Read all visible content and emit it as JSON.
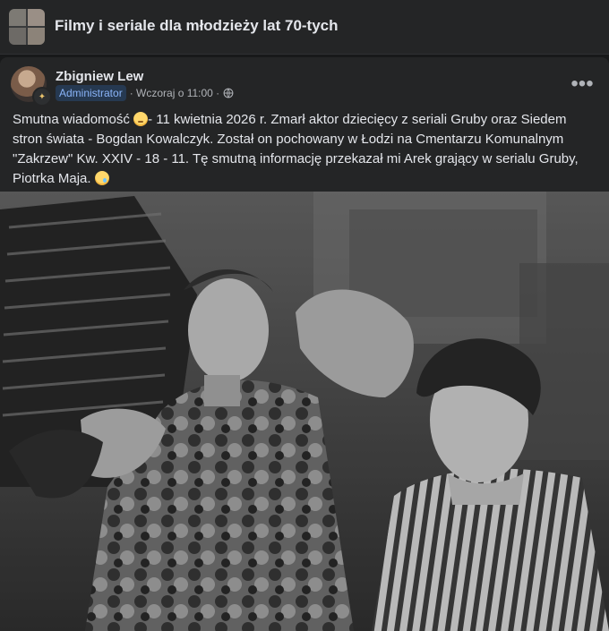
{
  "group": {
    "title": "Filmy i seriale dla młodzieży lat 70-tych"
  },
  "post": {
    "author": "Zbigniew Lew",
    "role": "Administrator",
    "time": "· Wczoraj o 11:00 ·",
    "text_part1": "Smutna wiadomość ",
    "text_part2": "- 11 kwietnia 2026 r. Zmarł aktor dziecięcy z seriali Gruby oraz Siedem stron świata - Bogdan Kowalczyk. Został on pochowany w Łodzi na Cmentarzu Komunalnym \"Zakrzew\" Kw. XXIV - 18 - 11. Tę smutną informację przekazał mi Arek grający w serialu Gruby, Piotrka Maja. ",
    "emoji_1": "sad-face",
    "emoji_2": "crying-face"
  },
  "icons": {
    "globe": "globe-icon",
    "more": "more-options-icon",
    "badge": "admin-badge-icon"
  }
}
